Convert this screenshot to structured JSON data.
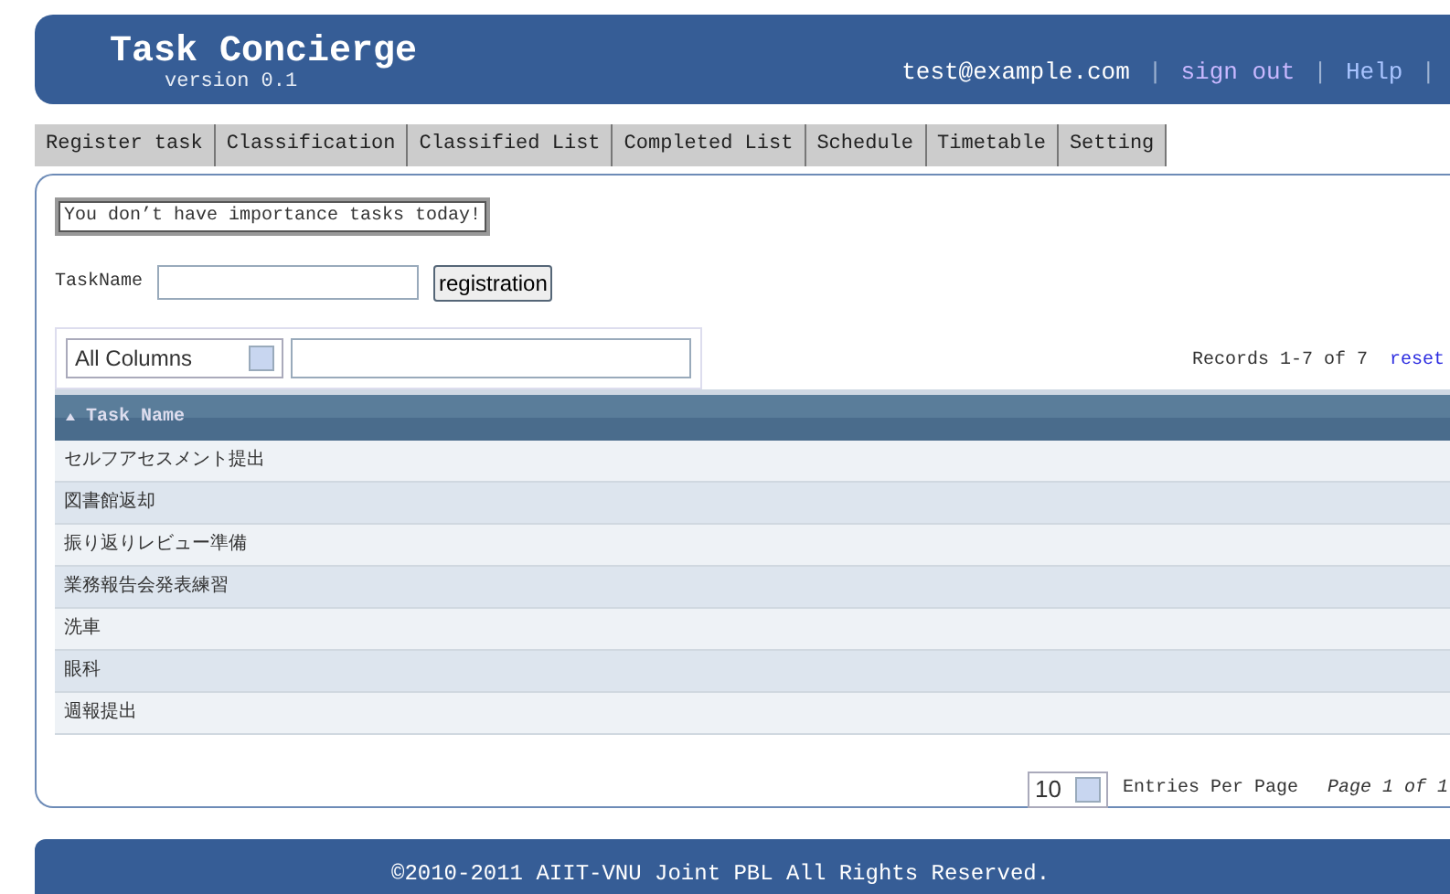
{
  "header": {
    "title": "Task Concierge",
    "version": "version 0.1",
    "items": [
      {
        "text": "test@example.com",
        "kind": "user"
      },
      {
        "text": "|",
        "kind": "separator"
      },
      {
        "text": "sign out",
        "kind": "visited-link"
      },
      {
        "text": "|",
        "kind": "separator"
      },
      {
        "text": "Help",
        "kind": "link"
      },
      {
        "text": "|",
        "kind": "separator"
      }
    ]
  },
  "tabs": [
    {
      "label": "Register task",
      "selected": false
    },
    {
      "label": "Classification",
      "selected": false
    },
    {
      "label": "Classified List",
      "selected": false
    },
    {
      "label": "Completed List",
      "selected": false
    },
    {
      "label": "Schedule",
      "selected": false
    },
    {
      "label": "Timetable",
      "selected": false
    },
    {
      "label": "Setting",
      "selected": false
    }
  ],
  "notice": "You don’t have importance tasks today!",
  "register": {
    "label": "TaskName",
    "button": "registration"
  },
  "filter": {
    "column": "All Columns",
    "records": "Records 1-7 of 7",
    "reset": "reset"
  },
  "table": {
    "columns": [
      "Task Name"
    ],
    "rows": [
      "セルフアセスメント提出",
      "図書館返却",
      "振り返りレビュー準備",
      "業務報告会発表練習",
      "洗車",
      "眼科",
      "週報提出"
    ]
  },
  "pager": {
    "per_page": "10",
    "per_page_label": "Entries Per Page",
    "page": "Page 1 of 1"
  },
  "footer": "©2010-2011 AIIT-VNU Joint PBL All Rights Reserved."
}
